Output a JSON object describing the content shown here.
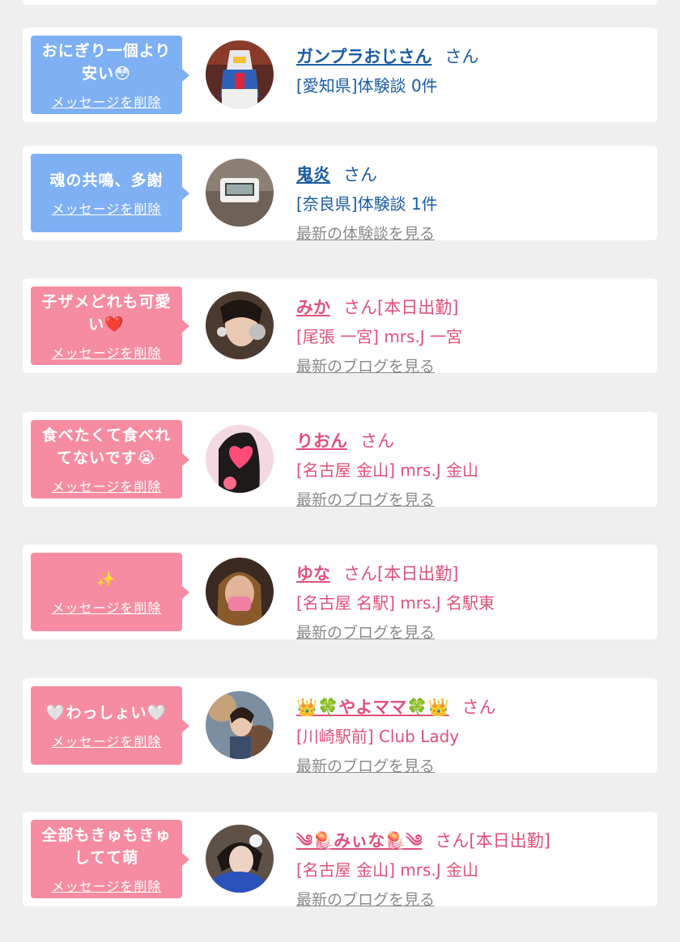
{
  "cards": [
    {
      "message": "おにぎり一個より安い😳",
      "delete_label": "メッセージを削除",
      "name": "ガンプラおじさん",
      "suffix": "さん",
      "detail": "[愛知県]体験談 0件",
      "link": "",
      "color": "#7fb0f3"
    },
    {
      "message": "魂の共鳴、多謝",
      "delete_label": "メッセージを削除",
      "name": "鬼炎",
      "suffix": "さん",
      "detail": "[奈良県]体験談 1件",
      "link": "最新の体験談を見る",
      "color": "#7fb0f3"
    },
    {
      "message": "子ザメどれも可愛い❤️",
      "delete_label": "メッセージを削除",
      "name": "みか",
      "suffix": "さん[本日出勤]",
      "detail": "[尾張 一宮] mrs.J 一宮",
      "link": "最新のブログを見る",
      "color": "#f58ca2"
    },
    {
      "message": "食べたくて食べれてないです😭",
      "delete_label": "メッセージを削除",
      "name": "りおん",
      "suffix": "さん",
      "detail": "[名古屋 金山] mrs.J 金山",
      "link": "最新のブログを見る",
      "color": "#f58ca2"
    },
    {
      "message": "✨",
      "delete_label": "メッセージを削除",
      "name": "ゆな",
      "suffix": "さん[本日出勤]",
      "detail": "[名古屋 名駅] mrs.J 名駅東",
      "link": "最新のブログを見る",
      "color": "#f58ca2"
    },
    {
      "message": "🤍わっしょい🤍",
      "delete_label": "メッセージを削除",
      "name": "👑🍀やよママ🍀👑",
      "suffix": "さん",
      "detail": "[川崎駅前] Club Lady",
      "link": "最新のブログを見る",
      "color": "#f58ca2"
    },
    {
      "message": "全部もきゅもきゅしてて萌",
      "delete_label": "メッセージを削除",
      "name": "༄🪼みぃな🪼༄",
      "suffix": "さん[本日出勤]",
      "detail": "[名古屋 金山] mrs.J 金山",
      "link": "最新のブログを見る",
      "color": "#f58ca2"
    }
  ]
}
